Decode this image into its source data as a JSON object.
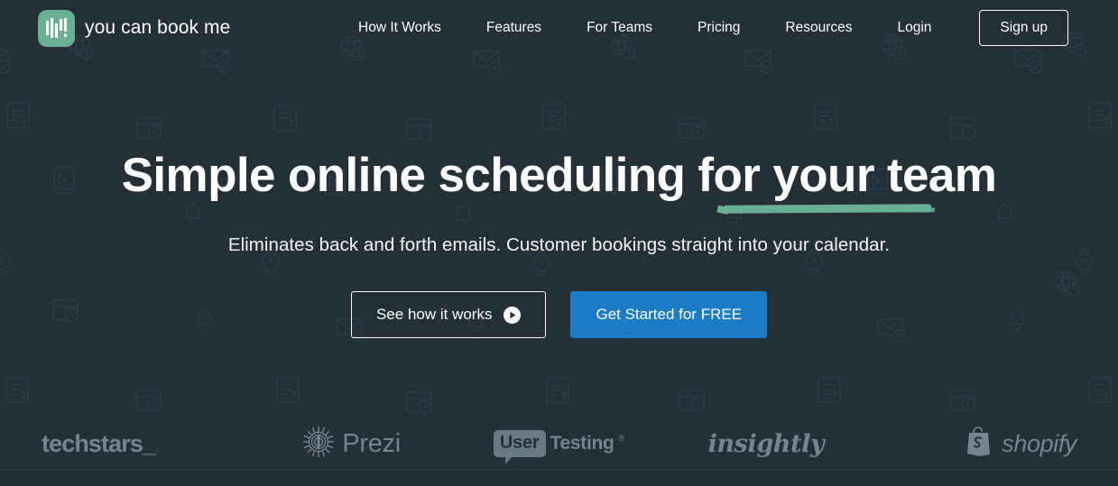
{
  "theme": {
    "background": "#242f36",
    "accent_green": "#6aae93",
    "accent_blue": "#1b7bc4",
    "text": "#ffffff",
    "muted_logo": "#76848c"
  },
  "header": {
    "brand": {
      "logo_icon": "bar-chart-logo-icon",
      "name": "you can book me"
    },
    "nav_links": [
      {
        "label": "How It Works"
      },
      {
        "label": "Features"
      },
      {
        "label": "For Teams"
      },
      {
        "label": "Pricing"
      },
      {
        "label": "Resources"
      },
      {
        "label": "Login"
      }
    ],
    "signup_label": "Sign up"
  },
  "hero": {
    "title": "Simple online scheduling for your team",
    "title_highlight": "your team",
    "subtitle": "Eliminates back and forth emails. Customer bookings straight into your calendar.",
    "cta_secondary": {
      "label": "See how it works",
      "icon": "play-circle-icon"
    },
    "cta_primary": {
      "label": "Get Started for FREE"
    }
  },
  "client_logos": [
    {
      "name": "techstars",
      "text": "techstars_",
      "icon": null
    },
    {
      "name": "prezi",
      "text": "Prezi",
      "icon": "prezi-sunburst-icon"
    },
    {
      "name": "usertesting",
      "text_badge": "User",
      "text": "Testing",
      "tm": "®"
    },
    {
      "name": "insightly",
      "text": "insightly",
      "icon": null
    },
    {
      "name": "shopify",
      "text": "shopify",
      "icon": "shopify-bag-icon"
    }
  ],
  "background_pattern": {
    "icons": [
      "receipt-icon",
      "calendar-clock-icon",
      "envelope-check-icon",
      "tablet-icon",
      "globe-clock-icon",
      "watch-icon",
      "bell-icon"
    ],
    "stroke_color": "#2c373e"
  }
}
